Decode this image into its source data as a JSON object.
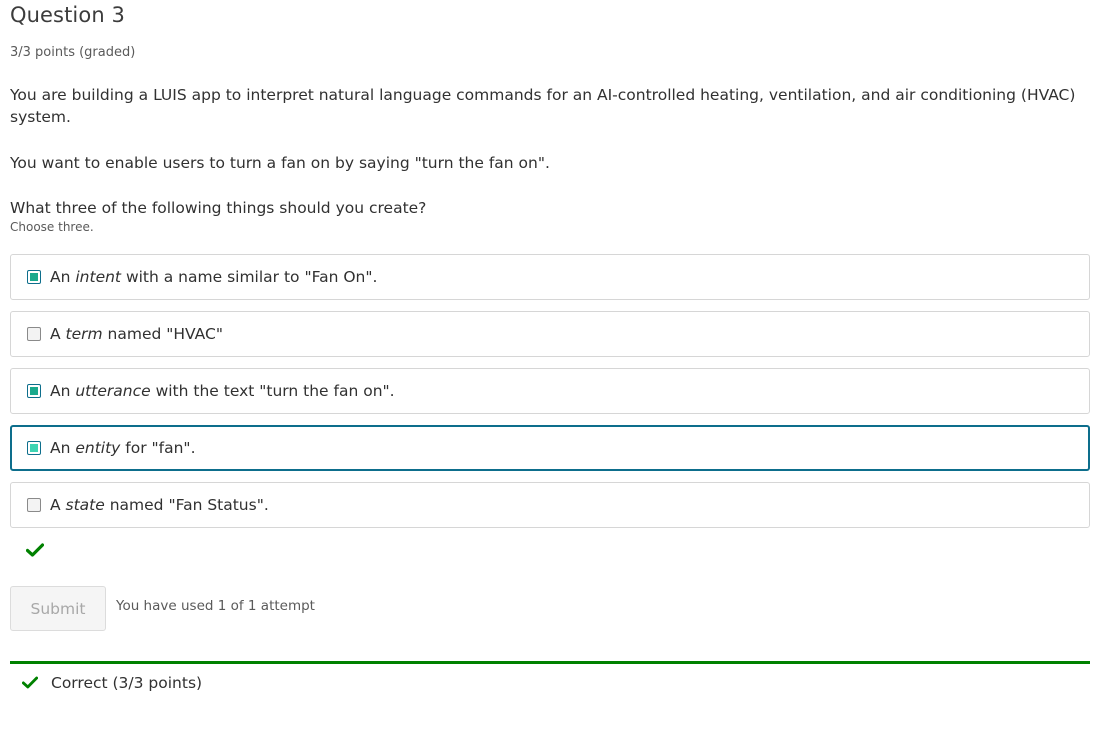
{
  "problem": {
    "title": "Question 3",
    "points": "3/3 points (graded)",
    "paragraph1": "You are building a LUIS app to interpret natural language commands for an AI-controlled heating, ventilation, and air conditioning (HVAC) system.",
    "paragraph2": "You want to enable users to turn a fan on by saying \"turn the fan on\".",
    "question": "What three of the following things should you create?",
    "hint": "Choose three."
  },
  "options": [
    {
      "prefix": "An ",
      "emphasis": "intent",
      "suffix": " with a name similar to \"Fan On\".",
      "checked": true
    },
    {
      "prefix": "A ",
      "emphasis": "term",
      "suffix": " named \"HVAC\"",
      "checked": false
    },
    {
      "prefix": "An ",
      "emphasis": "utterance",
      "suffix": " with the text \"turn the fan on\".",
      "checked": true
    },
    {
      "prefix": "An ",
      "emphasis": "entity",
      "suffix": " for \"fan\".",
      "checked": true
    },
    {
      "prefix": "A ",
      "emphasis": "state",
      "suffix": " named \"Fan Status\".",
      "checked": false
    }
  ],
  "actions": {
    "submit_label": "Submit",
    "attempts_text": "You have used 1 of 1 attempt"
  },
  "result": {
    "text": "Correct (3/3 points)",
    "color": "#008100"
  },
  "icons": {
    "status": "checkmark-icon",
    "result": "checkmark-icon"
  },
  "colors": {
    "accent": "#0d6e8c",
    "checkbox_fill": "#1aa98d",
    "success": "#008100"
  }
}
